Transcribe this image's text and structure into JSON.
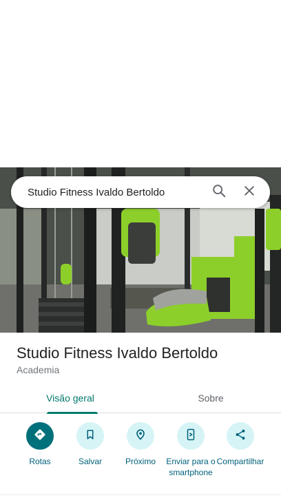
{
  "search": {
    "query": "Studio Fitness Ivaldo Bertoldo",
    "search_icon": "search-icon",
    "close_icon": "close-icon"
  },
  "place": {
    "title": "Studio Fitness Ivaldo Bertoldo",
    "category": "Academia"
  },
  "tabs": [
    {
      "label": "Visão geral",
      "active": true
    },
    {
      "label": "Sobre",
      "active": false
    }
  ],
  "actions": [
    {
      "label": "Rotas",
      "icon": "directions-icon"
    },
    {
      "label": "Salvar",
      "icon": "bookmark-icon"
    },
    {
      "label": "Próximo",
      "icon": "nearby-icon"
    },
    {
      "label": "Enviar para o smartphone",
      "icon": "send-to-phone-icon"
    },
    {
      "label": "Compartilhar",
      "icon": "share-icon"
    }
  ],
  "colors": {
    "accent": "#00796b",
    "action_bg": "#d6f4f6",
    "primary_action_bg": "#00707a",
    "equipment_green": "#8dcf2a"
  }
}
